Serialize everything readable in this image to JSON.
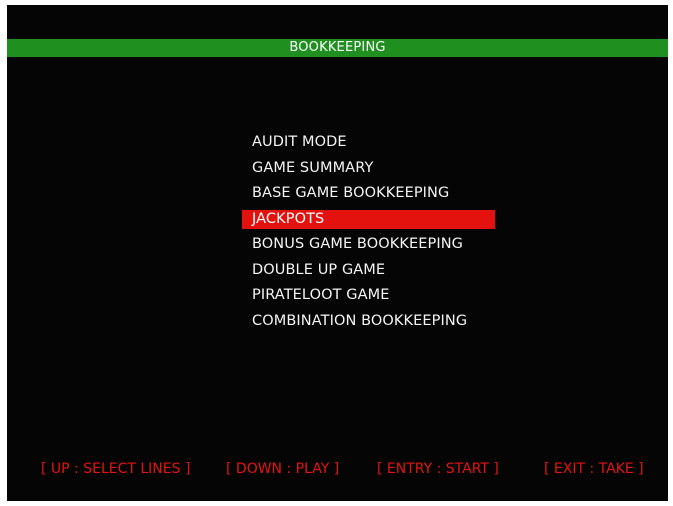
{
  "header": {
    "title": "BOOKKEEPING"
  },
  "menu": {
    "items": [
      {
        "label": "AUDIT MODE"
      },
      {
        "label": "GAME SUMMARY"
      },
      {
        "label": "BASE GAME BOOKKEEPING"
      },
      {
        "label": "JACKPOTS",
        "selected": true
      },
      {
        "label": "BONUS GAME BOOKKEEPING"
      },
      {
        "label": "DOUBLE UP GAME"
      },
      {
        "label": "PIRATELOOT GAME"
      },
      {
        "label": "COMBINATION BOOKKEEPING"
      }
    ]
  },
  "footer": {
    "hints": [
      "[ UP : SELECT LINES ]",
      "[ DOWN : PLAY ]",
      "[ ENTRY : START ]",
      "[ EXIT : TAKE ]"
    ]
  },
  "colors": {
    "background": "#050505",
    "title_bar": "#1f8f1f",
    "highlight": "#e3120e",
    "hint_text": "#e5140e",
    "menu_text": "#f4f4f4"
  }
}
